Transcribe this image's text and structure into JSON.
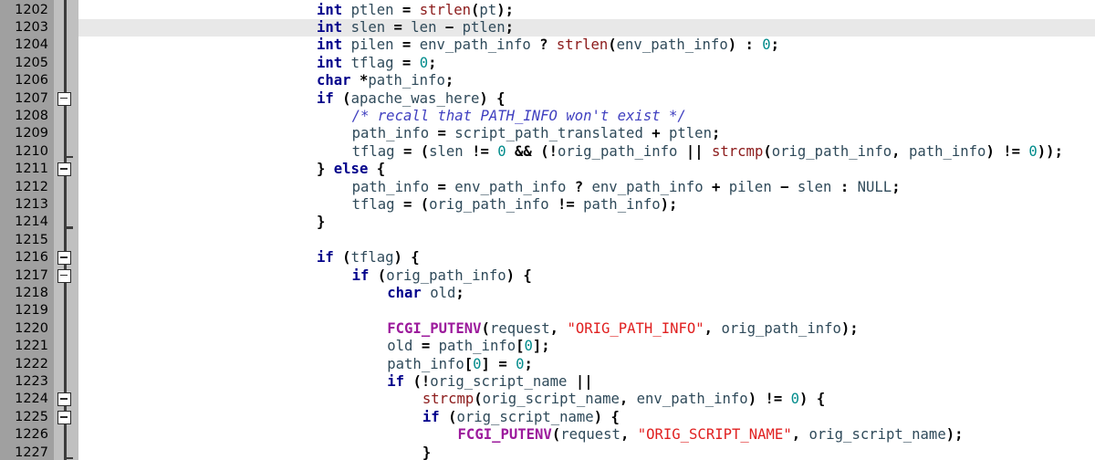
{
  "editor": {
    "name": "source-code-editor",
    "language": "C",
    "first_line": 1202,
    "last_line": 1227,
    "current_line": 1203,
    "line_height": 19.4,
    "colors": {
      "background": "#ffffff",
      "gutter_numbers_bg": "#a0a0a0",
      "gutter_fold_bg": "#c0c0c0",
      "fold_spine": "#3c3c3c",
      "current_line_highlight": "#e8e8e8",
      "keyword": "#00008b",
      "identifier": "#2f4a5a",
      "function": "#8b1a1a",
      "macro": "#9c1a9c",
      "string": "#e02020",
      "number": "#008b8b",
      "operator": "#000000",
      "comment": "#4040c0"
    }
  },
  "gutter": {
    "line_numbers": [
      "1202",
      "1203",
      "1204",
      "1205",
      "1206",
      "1207",
      "1208",
      "1209",
      "1210",
      "1211",
      "1212",
      "1213",
      "1214",
      "1215",
      "1216",
      "1217",
      "1218",
      "1219",
      "1220",
      "1221",
      "1222",
      "1223",
      "1224",
      "1225",
      "1226",
      "1227"
    ],
    "fold_markers": [
      {
        "line": 1207,
        "type": "fold-open-box"
      },
      {
        "line": 1211,
        "type": "fold-open-box"
      },
      {
        "line": 1216,
        "type": "fold-open-box"
      },
      {
        "line": 1217,
        "type": "fold-open-box"
      },
      {
        "line": 1224,
        "type": "fold-open-box"
      },
      {
        "line": 1225,
        "type": "fold-open-box"
      }
    ],
    "fold_end_ticks": [
      {
        "line": 1210
      },
      {
        "line": 1214
      },
      {
        "line": 1227
      }
    ]
  },
  "code": {
    "lines": [
      {
        "n": 1202,
        "indent": 27,
        "tokens": [
          {
            "t": "int",
            "c": "kw"
          },
          {
            "t": " ",
            "c": "pln"
          },
          {
            "t": "ptlen",
            "c": "id"
          },
          {
            "t": " ",
            "c": "pln"
          },
          {
            "t": "=",
            "c": "op"
          },
          {
            "t": " ",
            "c": "pln"
          },
          {
            "t": "strlen",
            "c": "fn"
          },
          {
            "t": "(",
            "c": "op"
          },
          {
            "t": "pt",
            "c": "id"
          },
          {
            "t": ");",
            "c": "op"
          }
        ]
      },
      {
        "n": 1203,
        "indent": 27,
        "tokens": [
          {
            "t": "int",
            "c": "kw"
          },
          {
            "t": " ",
            "c": "pln"
          },
          {
            "t": "slen",
            "c": "id"
          },
          {
            "t": " ",
            "c": "pln"
          },
          {
            "t": "=",
            "c": "op"
          },
          {
            "t": " ",
            "c": "pln"
          },
          {
            "t": "len",
            "c": "id"
          },
          {
            "t": " ",
            "c": "pln"
          },
          {
            "t": "−",
            "c": "op"
          },
          {
            "t": " ",
            "c": "pln"
          },
          {
            "t": "ptlen",
            "c": "id"
          },
          {
            "t": ";",
            "c": "op"
          }
        ]
      },
      {
        "n": 1204,
        "indent": 27,
        "tokens": [
          {
            "t": "int",
            "c": "kw"
          },
          {
            "t": " ",
            "c": "pln"
          },
          {
            "t": "pilen",
            "c": "id"
          },
          {
            "t": " ",
            "c": "pln"
          },
          {
            "t": "=",
            "c": "op"
          },
          {
            "t": " ",
            "c": "pln"
          },
          {
            "t": "env_path_info",
            "c": "id"
          },
          {
            "t": " ",
            "c": "pln"
          },
          {
            "t": "?",
            "c": "op"
          },
          {
            "t": " ",
            "c": "pln"
          },
          {
            "t": "strlen",
            "c": "fn"
          },
          {
            "t": "(",
            "c": "op"
          },
          {
            "t": "env_path_info",
            "c": "id"
          },
          {
            "t": ")",
            "c": "op"
          },
          {
            "t": " ",
            "c": "pln"
          },
          {
            "t": ":",
            "c": "op"
          },
          {
            "t": " ",
            "c": "pln"
          },
          {
            "t": "0",
            "c": "num"
          },
          {
            "t": ";",
            "c": "op"
          }
        ]
      },
      {
        "n": 1205,
        "indent": 27,
        "tokens": [
          {
            "t": "int",
            "c": "kw"
          },
          {
            "t": " ",
            "c": "pln"
          },
          {
            "t": "tflag",
            "c": "id"
          },
          {
            "t": " ",
            "c": "pln"
          },
          {
            "t": "=",
            "c": "op"
          },
          {
            "t": " ",
            "c": "pln"
          },
          {
            "t": "0",
            "c": "num"
          },
          {
            "t": ";",
            "c": "op"
          }
        ]
      },
      {
        "n": 1206,
        "indent": 27,
        "tokens": [
          {
            "t": "char",
            "c": "kw"
          },
          {
            "t": " ",
            "c": "pln"
          },
          {
            "t": "*",
            "c": "op"
          },
          {
            "t": "path_info",
            "c": "id"
          },
          {
            "t": ";",
            "c": "op"
          }
        ]
      },
      {
        "n": 1207,
        "indent": 27,
        "tokens": [
          {
            "t": "if",
            "c": "kw"
          },
          {
            "t": " ",
            "c": "pln"
          },
          {
            "t": "(",
            "c": "op"
          },
          {
            "t": "apache_was_here",
            "c": "id"
          },
          {
            "t": ") {",
            "c": "op"
          }
        ]
      },
      {
        "n": 1208,
        "indent": 31,
        "tokens": [
          {
            "t": "/* recall that PATH_INFO won't exist */",
            "c": "cmt"
          }
        ]
      },
      {
        "n": 1209,
        "indent": 31,
        "tokens": [
          {
            "t": "path_info",
            "c": "id"
          },
          {
            "t": " ",
            "c": "pln"
          },
          {
            "t": "=",
            "c": "op"
          },
          {
            "t": " ",
            "c": "pln"
          },
          {
            "t": "script_path_translated",
            "c": "id"
          },
          {
            "t": " ",
            "c": "pln"
          },
          {
            "t": "+",
            "c": "op"
          },
          {
            "t": " ",
            "c": "pln"
          },
          {
            "t": "ptlen",
            "c": "id"
          },
          {
            "t": ";",
            "c": "op"
          }
        ]
      },
      {
        "n": 1210,
        "indent": 31,
        "tokens": [
          {
            "t": "tflag",
            "c": "id"
          },
          {
            "t": " ",
            "c": "pln"
          },
          {
            "t": "=",
            "c": "op"
          },
          {
            "t": " ",
            "c": "pln"
          },
          {
            "t": "(",
            "c": "op"
          },
          {
            "t": "slen",
            "c": "id"
          },
          {
            "t": " ",
            "c": "pln"
          },
          {
            "t": "!=",
            "c": "op"
          },
          {
            "t": " ",
            "c": "pln"
          },
          {
            "t": "0",
            "c": "num"
          },
          {
            "t": " ",
            "c": "pln"
          },
          {
            "t": "&&",
            "c": "op"
          },
          {
            "t": " ",
            "c": "pln"
          },
          {
            "t": "(!",
            "c": "op"
          },
          {
            "t": "orig_path_info",
            "c": "id"
          },
          {
            "t": " ",
            "c": "pln"
          },
          {
            "t": "||",
            "c": "op"
          },
          {
            "t": " ",
            "c": "pln"
          },
          {
            "t": "strcmp",
            "c": "fn"
          },
          {
            "t": "(",
            "c": "op"
          },
          {
            "t": "orig_path_info",
            "c": "id"
          },
          {
            "t": ", ",
            "c": "op"
          },
          {
            "t": "path_info",
            "c": "id"
          },
          {
            "t": ")",
            "c": "op"
          },
          {
            "t": " ",
            "c": "pln"
          },
          {
            "t": "!=",
            "c": "op"
          },
          {
            "t": " ",
            "c": "pln"
          },
          {
            "t": "0",
            "c": "num"
          },
          {
            "t": "));",
            "c": "op"
          }
        ]
      },
      {
        "n": 1211,
        "indent": 27,
        "tokens": [
          {
            "t": "}",
            "c": "op"
          },
          {
            "t": " ",
            "c": "pln"
          },
          {
            "t": "else",
            "c": "kw"
          },
          {
            "t": " ",
            "c": "pln"
          },
          {
            "t": "{",
            "c": "op"
          }
        ]
      },
      {
        "n": 1212,
        "indent": 31,
        "tokens": [
          {
            "t": "path_info",
            "c": "id"
          },
          {
            "t": " ",
            "c": "pln"
          },
          {
            "t": "=",
            "c": "op"
          },
          {
            "t": " ",
            "c": "pln"
          },
          {
            "t": "env_path_info",
            "c": "id"
          },
          {
            "t": " ",
            "c": "pln"
          },
          {
            "t": "?",
            "c": "op"
          },
          {
            "t": " ",
            "c": "pln"
          },
          {
            "t": "env_path_info",
            "c": "id"
          },
          {
            "t": " ",
            "c": "pln"
          },
          {
            "t": "+",
            "c": "op"
          },
          {
            "t": " ",
            "c": "pln"
          },
          {
            "t": "pilen",
            "c": "id"
          },
          {
            "t": " ",
            "c": "pln"
          },
          {
            "t": "−",
            "c": "op"
          },
          {
            "t": " ",
            "c": "pln"
          },
          {
            "t": "slen",
            "c": "id"
          },
          {
            "t": " ",
            "c": "pln"
          },
          {
            "t": ":",
            "c": "op"
          },
          {
            "t": " ",
            "c": "pln"
          },
          {
            "t": "NULL",
            "c": "plnb"
          },
          {
            "t": ";",
            "c": "op"
          }
        ]
      },
      {
        "n": 1213,
        "indent": 31,
        "tokens": [
          {
            "t": "tflag",
            "c": "id"
          },
          {
            "t": " ",
            "c": "pln"
          },
          {
            "t": "=",
            "c": "op"
          },
          {
            "t": " ",
            "c": "pln"
          },
          {
            "t": "(",
            "c": "op"
          },
          {
            "t": "orig_path_info",
            "c": "id"
          },
          {
            "t": " ",
            "c": "pln"
          },
          {
            "t": "!=",
            "c": "op"
          },
          {
            "t": " ",
            "c": "pln"
          },
          {
            "t": "path_info",
            "c": "id"
          },
          {
            "t": ");",
            "c": "op"
          }
        ]
      },
      {
        "n": 1214,
        "indent": 27,
        "tokens": [
          {
            "t": "}",
            "c": "op"
          }
        ]
      },
      {
        "n": 1215,
        "indent": 0,
        "tokens": []
      },
      {
        "n": 1216,
        "indent": 27,
        "tokens": [
          {
            "t": "if",
            "c": "kw"
          },
          {
            "t": " ",
            "c": "pln"
          },
          {
            "t": "(",
            "c": "op"
          },
          {
            "t": "tflag",
            "c": "id"
          },
          {
            "t": ") {",
            "c": "op"
          }
        ]
      },
      {
        "n": 1217,
        "indent": 31,
        "tokens": [
          {
            "t": "if",
            "c": "kw"
          },
          {
            "t": " ",
            "c": "pln"
          },
          {
            "t": "(",
            "c": "op"
          },
          {
            "t": "orig_path_info",
            "c": "id"
          },
          {
            "t": ") {",
            "c": "op"
          }
        ]
      },
      {
        "n": 1218,
        "indent": 35,
        "tokens": [
          {
            "t": "char",
            "c": "kw"
          },
          {
            "t": " ",
            "c": "pln"
          },
          {
            "t": "old",
            "c": "id"
          },
          {
            "t": ";",
            "c": "op"
          }
        ]
      },
      {
        "n": 1219,
        "indent": 0,
        "tokens": []
      },
      {
        "n": 1220,
        "indent": 35,
        "tokens": [
          {
            "t": "FCGI_PUTENV",
            "c": "mac"
          },
          {
            "t": "(",
            "c": "op"
          },
          {
            "t": "request",
            "c": "id"
          },
          {
            "t": ", ",
            "c": "op"
          },
          {
            "t": "\"ORIG_PATH_INFO\"",
            "c": "str"
          },
          {
            "t": ", ",
            "c": "op"
          },
          {
            "t": "orig_path_info",
            "c": "id"
          },
          {
            "t": ");",
            "c": "op"
          }
        ]
      },
      {
        "n": 1221,
        "indent": 35,
        "tokens": [
          {
            "t": "old",
            "c": "id"
          },
          {
            "t": " ",
            "c": "pln"
          },
          {
            "t": "=",
            "c": "op"
          },
          {
            "t": " ",
            "c": "pln"
          },
          {
            "t": "path_info",
            "c": "id"
          },
          {
            "t": "[",
            "c": "op"
          },
          {
            "t": "0",
            "c": "num"
          },
          {
            "t": "];",
            "c": "op"
          }
        ]
      },
      {
        "n": 1222,
        "indent": 35,
        "tokens": [
          {
            "t": "path_info",
            "c": "id"
          },
          {
            "t": "[",
            "c": "op"
          },
          {
            "t": "0",
            "c": "num"
          },
          {
            "t": "]",
            "c": "op"
          },
          {
            "t": " ",
            "c": "pln"
          },
          {
            "t": "=",
            "c": "op"
          },
          {
            "t": " ",
            "c": "pln"
          },
          {
            "t": "0",
            "c": "num"
          },
          {
            "t": ";",
            "c": "op"
          }
        ]
      },
      {
        "n": 1223,
        "indent": 35,
        "tokens": [
          {
            "t": "if",
            "c": "kw"
          },
          {
            "t": " ",
            "c": "pln"
          },
          {
            "t": "(!",
            "c": "op"
          },
          {
            "t": "orig_script_name",
            "c": "id"
          },
          {
            "t": " ",
            "c": "pln"
          },
          {
            "t": "||",
            "c": "op"
          }
        ]
      },
      {
        "n": 1224,
        "indent": 39,
        "tokens": [
          {
            "t": "strcmp",
            "c": "fn"
          },
          {
            "t": "(",
            "c": "op"
          },
          {
            "t": "orig_script_name",
            "c": "id"
          },
          {
            "t": ", ",
            "c": "op"
          },
          {
            "t": "env_path_info",
            "c": "id"
          },
          {
            "t": ")",
            "c": "op"
          },
          {
            "t": " ",
            "c": "pln"
          },
          {
            "t": "!=",
            "c": "op"
          },
          {
            "t": " ",
            "c": "pln"
          },
          {
            "t": "0",
            "c": "num"
          },
          {
            "t": ") {",
            "c": "op"
          }
        ]
      },
      {
        "n": 1225,
        "indent": 39,
        "tokens": [
          {
            "t": "if",
            "c": "kw"
          },
          {
            "t": " ",
            "c": "pln"
          },
          {
            "t": "(",
            "c": "op"
          },
          {
            "t": "orig_script_name",
            "c": "id"
          },
          {
            "t": ") {",
            "c": "op"
          }
        ]
      },
      {
        "n": 1226,
        "indent": 43,
        "tokens": [
          {
            "t": "FCGI_PUTENV",
            "c": "mac"
          },
          {
            "t": "(",
            "c": "op"
          },
          {
            "t": "request",
            "c": "id"
          },
          {
            "t": ", ",
            "c": "op"
          },
          {
            "t": "\"ORIG_SCRIPT_NAME\"",
            "c": "str"
          },
          {
            "t": ", ",
            "c": "op"
          },
          {
            "t": "orig_script_name",
            "c": "id"
          },
          {
            "t": ");",
            "c": "op"
          }
        ]
      },
      {
        "n": 1227,
        "indent": 39,
        "tokens": [
          {
            "t": "}",
            "c": "op"
          }
        ]
      }
    ]
  }
}
